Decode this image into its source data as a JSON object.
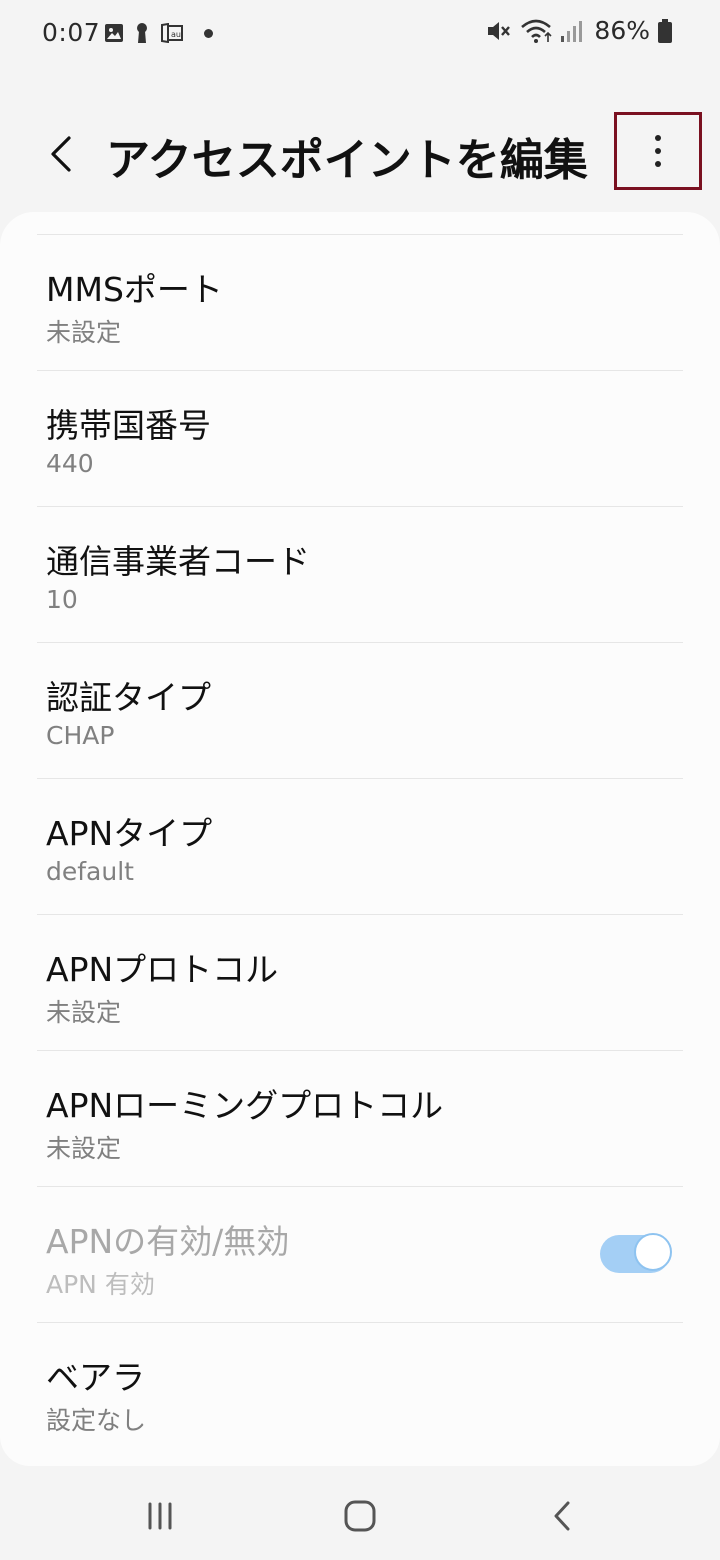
{
  "status_bar": {
    "time": "0:07",
    "battery_percent": "86%",
    "icons_left": [
      "image-icon",
      "keyhole-icon",
      "au-icon",
      "notification-dot"
    ],
    "icons_right": [
      "mute-icon",
      "wifi-icon",
      "signal-icon",
      "battery-icon"
    ]
  },
  "header": {
    "title": "アクセスポイントを編集",
    "back_icon": "back-chevron-icon",
    "more_icon": "more-options-icon"
  },
  "settings": [
    {
      "label": "MMSポート",
      "value": "未設定"
    },
    {
      "label": "携帯国番号",
      "value": "440"
    },
    {
      "label": "通信事業者コード",
      "value": "10"
    },
    {
      "label": "認証タイプ",
      "value": "CHAP"
    },
    {
      "label": "APNタイプ",
      "value": "default"
    },
    {
      "label": "APNプロトコル",
      "value": "未設定"
    },
    {
      "label": "APNローミングプロトコル",
      "value": "未設定"
    },
    {
      "label": "APNの有効/無効",
      "value": "APN 有効",
      "toggle_on": true,
      "disabled": true
    },
    {
      "label": "ベアラ",
      "value": "設定なし"
    }
  ],
  "nav_bar": {
    "recents_icon": "recents-icon",
    "home_icon": "home-icon",
    "back_icon": "back-icon"
  },
  "colors": {
    "background": "#f4f4f4",
    "card": "#fcfcfc",
    "highlight_border": "#7a1020",
    "toggle_track": "#a4cff5"
  }
}
